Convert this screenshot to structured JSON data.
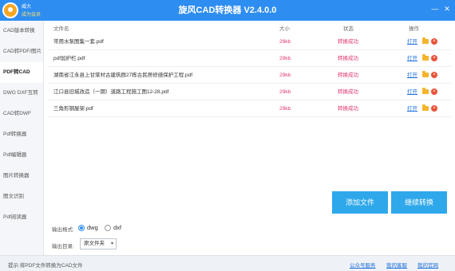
{
  "titlebar": {
    "user_name": "威大",
    "vip_label": "成为会员",
    "title": "旋风CAD转换器 V2.4.0.0",
    "min_symbol": "—",
    "close_symbol": "✕"
  },
  "sidebar": {
    "items": [
      {
        "label": "CAD版本转换"
      },
      {
        "label": "CAD转PDF/图片"
      },
      {
        "label": "PDF转CAD"
      },
      {
        "label": "DWG DXF互转"
      },
      {
        "label": "CAD转DWF"
      },
      {
        "label": "Pdf转换器"
      },
      {
        "label": "Pdf编辑器"
      },
      {
        "label": "图片转换器"
      },
      {
        "label": "图文识别"
      },
      {
        "label": "Pdf阅读器"
      }
    ],
    "active_index": 2
  },
  "table": {
    "headers": {
      "name": "文件名",
      "size": "大小",
      "status": "状态",
      "actions": "操作"
    },
    "open_label": "打开",
    "delete_symbol": "×",
    "rows": [
      {
        "name": "常用水泵图集一套.pdf",
        "size": "29kb",
        "status": "转换成功"
      },
      {
        "name": "pdf加护栏.pdf",
        "size": "29kb",
        "status": "转换成功"
      },
      {
        "name": "湖南省江永县上甘棠村古建筑群27栋古民居修缮保护工程.pdf",
        "size": "29kb",
        "status": "转换成功"
      },
      {
        "name": "江口县旧城改造（一期）道路工程施工图12-28.pdf",
        "size": "29kb",
        "status": "转换成功"
      },
      {
        "name": "三角形钢屋架.pdf",
        "size": "29kb",
        "status": "转换成功"
      }
    ]
  },
  "actions": {
    "add_file": "添加文件",
    "continue": "继续转换"
  },
  "options": {
    "format_label": "输出格式:",
    "formats": [
      "dwg",
      "dxf"
    ],
    "selected_format": "dwg",
    "dir_label": "输出目录:",
    "dir_value": "原文件夹",
    "dir_arrow": "▾"
  },
  "footer": {
    "tip": "提示:将PDF文件转换为CAD文件",
    "links": [
      "公众号服务",
      "我的客服",
      "我的官网"
    ]
  },
  "colors": {
    "accent": "#2e8df1",
    "button": "#2ea8ea",
    "success": "#e0346e",
    "link": "#1e6fd9"
  }
}
